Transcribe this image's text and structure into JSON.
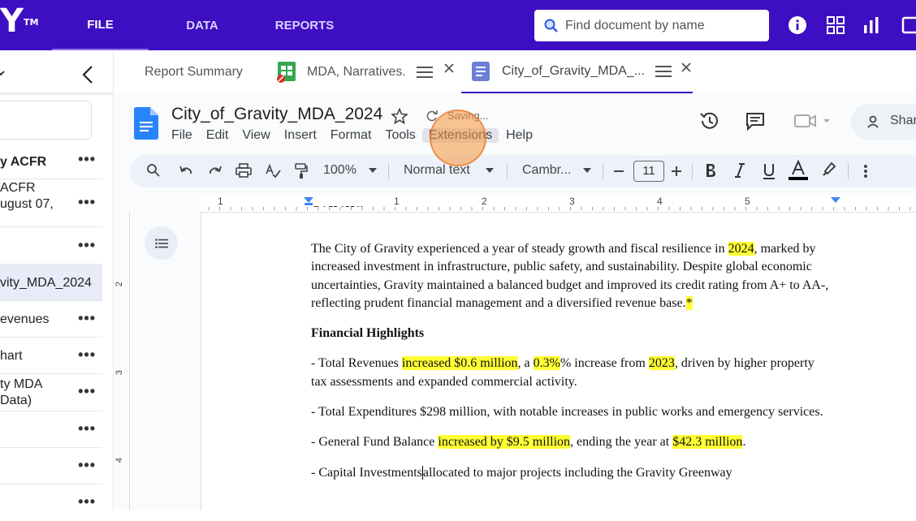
{
  "app": {
    "logo": "Y",
    "tm": "TM"
  },
  "nav": {
    "file": "FILE",
    "data": "DATA",
    "reports": "REPORTS"
  },
  "search": {
    "placeholder": "Find document by name"
  },
  "sidebar": {
    "items": [
      {
        "label": "y ACFR"
      },
      {
        "label": "ACFR",
        "label2": "ugust 07,"
      },
      {
        "label": ""
      },
      {
        "label": "vity_MDA_2024"
      },
      {
        "label": "evenues"
      },
      {
        "label": "hart"
      },
      {
        "label": "ty MDA",
        "label2": " Data)"
      },
      {
        "label": ""
      },
      {
        "label": ""
      },
      {
        "label": ""
      }
    ],
    "dots": "•••"
  },
  "tabs": [
    {
      "label": "Report Summary"
    },
    {
      "label": "MDA, Narratives."
    },
    {
      "label": "City_of_Gravity_MDA_..."
    }
  ],
  "doc": {
    "title": "City_of_Gravity_MDA_2024",
    "status": "Saving...",
    "menu": [
      "File",
      "Edit",
      "View",
      "Insert",
      "Format",
      "Tools",
      "Extensions",
      "Help"
    ],
    "share": "Shar",
    "zoom": "100%",
    "style": "Normal text",
    "font": "Cambr...",
    "font_size": "11",
    "ruler_marks": [
      "1",
      "1",
      "2",
      "3",
      "4",
      "5"
    ],
    "vruler_marks": [
      "2",
      "3",
      "4"
    ],
    "heading_cut": "Overview",
    "p1": {
      "a": "The City of Gravity experienced a year of steady growth and fiscal resilience in ",
      "b": "2024",
      "c": ", marked by increased investment in infrastructure, public safety, and sustainability. Despite global economic uncertainties, Gravity maintained a balanced budget and improved its credit rating from A+ to AA-, reflecting prudent financial management and a diversified revenue base.",
      "d": "*"
    },
    "h2": "Financial Highlights",
    "p2": {
      "a": "- Total Revenues ",
      "b": "increased $0.6 million",
      "c": ", a ",
      "d": "0.3%",
      "e": "% increase from ",
      "f": "2023",
      "g": ", driven by higher property tax assessments and expanded commercial activity."
    },
    "p3": "- Total Expenditures $298 million, with notable increases in public works and emergency services.",
    "p4": {
      "a": "- General Fund Balance ",
      "b": "increased by $9.5 million",
      "c": ", ending the year at ",
      "d": "$42.3 million",
      "e": "."
    },
    "p5": {
      "a": "- Capital Investments ",
      "b": "allocated to major projects including the Gravity Greenway"
    }
  },
  "colors": {
    "brand": "#3d0ec2",
    "highlight": "#ffff33",
    "click": "#f5963c"
  }
}
